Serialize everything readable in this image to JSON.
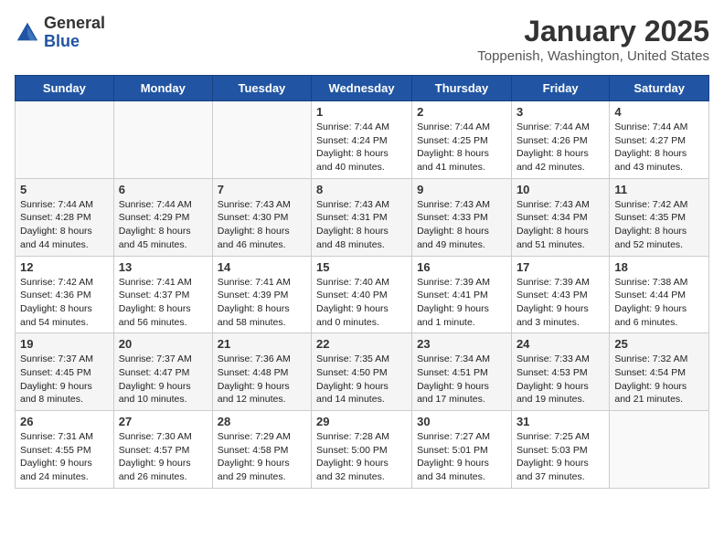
{
  "logo": {
    "general": "General",
    "blue": "Blue"
  },
  "header": {
    "month": "January 2025",
    "location": "Toppenish, Washington, United States"
  },
  "days_of_week": [
    "Sunday",
    "Monday",
    "Tuesday",
    "Wednesday",
    "Thursday",
    "Friday",
    "Saturday"
  ],
  "weeks": [
    [
      {
        "day": "",
        "info": ""
      },
      {
        "day": "",
        "info": ""
      },
      {
        "day": "",
        "info": ""
      },
      {
        "day": "1",
        "info": "Sunrise: 7:44 AM\nSunset: 4:24 PM\nDaylight: 8 hours and 40 minutes."
      },
      {
        "day": "2",
        "info": "Sunrise: 7:44 AM\nSunset: 4:25 PM\nDaylight: 8 hours and 41 minutes."
      },
      {
        "day": "3",
        "info": "Sunrise: 7:44 AM\nSunset: 4:26 PM\nDaylight: 8 hours and 42 minutes."
      },
      {
        "day": "4",
        "info": "Sunrise: 7:44 AM\nSunset: 4:27 PM\nDaylight: 8 hours and 43 minutes."
      }
    ],
    [
      {
        "day": "5",
        "info": "Sunrise: 7:44 AM\nSunset: 4:28 PM\nDaylight: 8 hours and 44 minutes."
      },
      {
        "day": "6",
        "info": "Sunrise: 7:44 AM\nSunset: 4:29 PM\nDaylight: 8 hours and 45 minutes."
      },
      {
        "day": "7",
        "info": "Sunrise: 7:43 AM\nSunset: 4:30 PM\nDaylight: 8 hours and 46 minutes."
      },
      {
        "day": "8",
        "info": "Sunrise: 7:43 AM\nSunset: 4:31 PM\nDaylight: 8 hours and 48 minutes."
      },
      {
        "day": "9",
        "info": "Sunrise: 7:43 AM\nSunset: 4:33 PM\nDaylight: 8 hours and 49 minutes."
      },
      {
        "day": "10",
        "info": "Sunrise: 7:43 AM\nSunset: 4:34 PM\nDaylight: 8 hours and 51 minutes."
      },
      {
        "day": "11",
        "info": "Sunrise: 7:42 AM\nSunset: 4:35 PM\nDaylight: 8 hours and 52 minutes."
      }
    ],
    [
      {
        "day": "12",
        "info": "Sunrise: 7:42 AM\nSunset: 4:36 PM\nDaylight: 8 hours and 54 minutes."
      },
      {
        "day": "13",
        "info": "Sunrise: 7:41 AM\nSunset: 4:37 PM\nDaylight: 8 hours and 56 minutes."
      },
      {
        "day": "14",
        "info": "Sunrise: 7:41 AM\nSunset: 4:39 PM\nDaylight: 8 hours and 58 minutes."
      },
      {
        "day": "15",
        "info": "Sunrise: 7:40 AM\nSunset: 4:40 PM\nDaylight: 9 hours and 0 minutes."
      },
      {
        "day": "16",
        "info": "Sunrise: 7:39 AM\nSunset: 4:41 PM\nDaylight: 9 hours and 1 minute."
      },
      {
        "day": "17",
        "info": "Sunrise: 7:39 AM\nSunset: 4:43 PM\nDaylight: 9 hours and 3 minutes."
      },
      {
        "day": "18",
        "info": "Sunrise: 7:38 AM\nSunset: 4:44 PM\nDaylight: 9 hours and 6 minutes."
      }
    ],
    [
      {
        "day": "19",
        "info": "Sunrise: 7:37 AM\nSunset: 4:45 PM\nDaylight: 9 hours and 8 minutes."
      },
      {
        "day": "20",
        "info": "Sunrise: 7:37 AM\nSunset: 4:47 PM\nDaylight: 9 hours and 10 minutes."
      },
      {
        "day": "21",
        "info": "Sunrise: 7:36 AM\nSunset: 4:48 PM\nDaylight: 9 hours and 12 minutes."
      },
      {
        "day": "22",
        "info": "Sunrise: 7:35 AM\nSunset: 4:50 PM\nDaylight: 9 hours and 14 minutes."
      },
      {
        "day": "23",
        "info": "Sunrise: 7:34 AM\nSunset: 4:51 PM\nDaylight: 9 hours and 17 minutes."
      },
      {
        "day": "24",
        "info": "Sunrise: 7:33 AM\nSunset: 4:53 PM\nDaylight: 9 hours and 19 minutes."
      },
      {
        "day": "25",
        "info": "Sunrise: 7:32 AM\nSunset: 4:54 PM\nDaylight: 9 hours and 21 minutes."
      }
    ],
    [
      {
        "day": "26",
        "info": "Sunrise: 7:31 AM\nSunset: 4:55 PM\nDaylight: 9 hours and 24 minutes."
      },
      {
        "day": "27",
        "info": "Sunrise: 7:30 AM\nSunset: 4:57 PM\nDaylight: 9 hours and 26 minutes."
      },
      {
        "day": "28",
        "info": "Sunrise: 7:29 AM\nSunset: 4:58 PM\nDaylight: 9 hours and 29 minutes."
      },
      {
        "day": "29",
        "info": "Sunrise: 7:28 AM\nSunset: 5:00 PM\nDaylight: 9 hours and 32 minutes."
      },
      {
        "day": "30",
        "info": "Sunrise: 7:27 AM\nSunset: 5:01 PM\nDaylight: 9 hours and 34 minutes."
      },
      {
        "day": "31",
        "info": "Sunrise: 7:25 AM\nSunset: 5:03 PM\nDaylight: 9 hours and 37 minutes."
      },
      {
        "day": "",
        "info": ""
      }
    ]
  ]
}
